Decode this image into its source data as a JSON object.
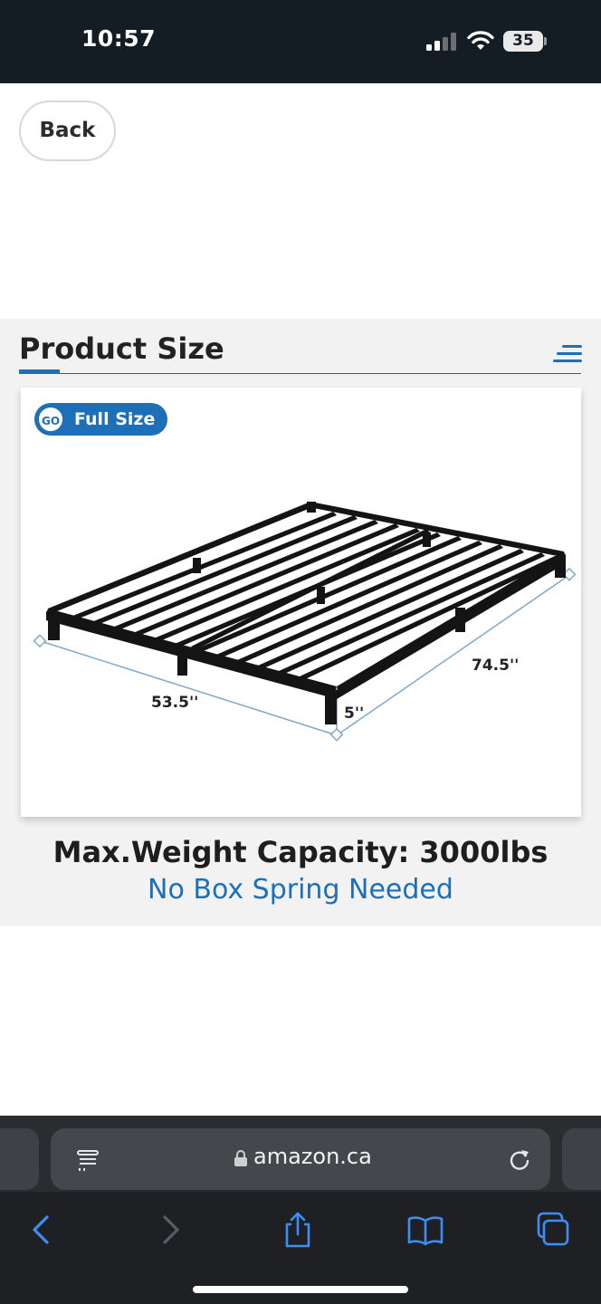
{
  "status_bar": {
    "time": "10:57",
    "battery_level": "35",
    "icons": [
      "signal-icon",
      "wifi-icon",
      "battery-icon"
    ]
  },
  "nav": {
    "back_label": "Back"
  },
  "section": {
    "title": "Product Size",
    "menu_icon": "menu-icon"
  },
  "product_image": {
    "badge_icon_text": "GO",
    "size_label": "Full Size",
    "dimensions": {
      "width": "53.5''",
      "length": "74.5''",
      "height": "5''"
    }
  },
  "details": {
    "capacity": "Max.Weight Capacity: 3000lbs",
    "box_spring": "No Box Spring Needed"
  },
  "browser": {
    "url": "amazon.ca",
    "icons": [
      "reader-icon",
      "lock-icon",
      "reload-icon"
    ],
    "toolbar": [
      "back-arrow-icon",
      "forward-arrow-icon",
      "share-icon",
      "bookmarks-icon",
      "tabs-icon"
    ]
  },
  "colors": {
    "accent_blue": "#1d6fb8",
    "status_bar_bg": "#141c24",
    "browser_bg": "#2a2c30"
  }
}
